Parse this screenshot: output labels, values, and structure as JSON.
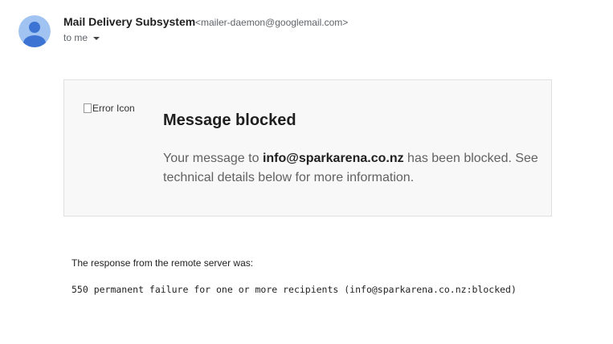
{
  "header": {
    "avatar_icon": "default-person-avatar",
    "sender_name": "Mail Delivery Subsystem",
    "sender_email": "<mailer-daemon@googlemail.com>",
    "recipient_label": "to me",
    "recipient_dropdown_icon": "caret-down-icon"
  },
  "notice": {
    "icon_alt": "Error Icon",
    "title": "Message blocked",
    "text_before": "Your message to ",
    "blocked_address": "info@sparkarena.co.nz",
    "text_after": " has been blocked. See technical details below for more information."
  },
  "details": {
    "response_label": "The response from the remote server was:",
    "response_code": "550 permanent failure for one or more recipients (info@sparkarena.co.nz:blocked)"
  },
  "colors": {
    "avatar_background": "#a0c3f2",
    "avatar_person": "#3d74d4",
    "card_background": "#f8f8f8",
    "card_border": "#e0e0e0"
  }
}
